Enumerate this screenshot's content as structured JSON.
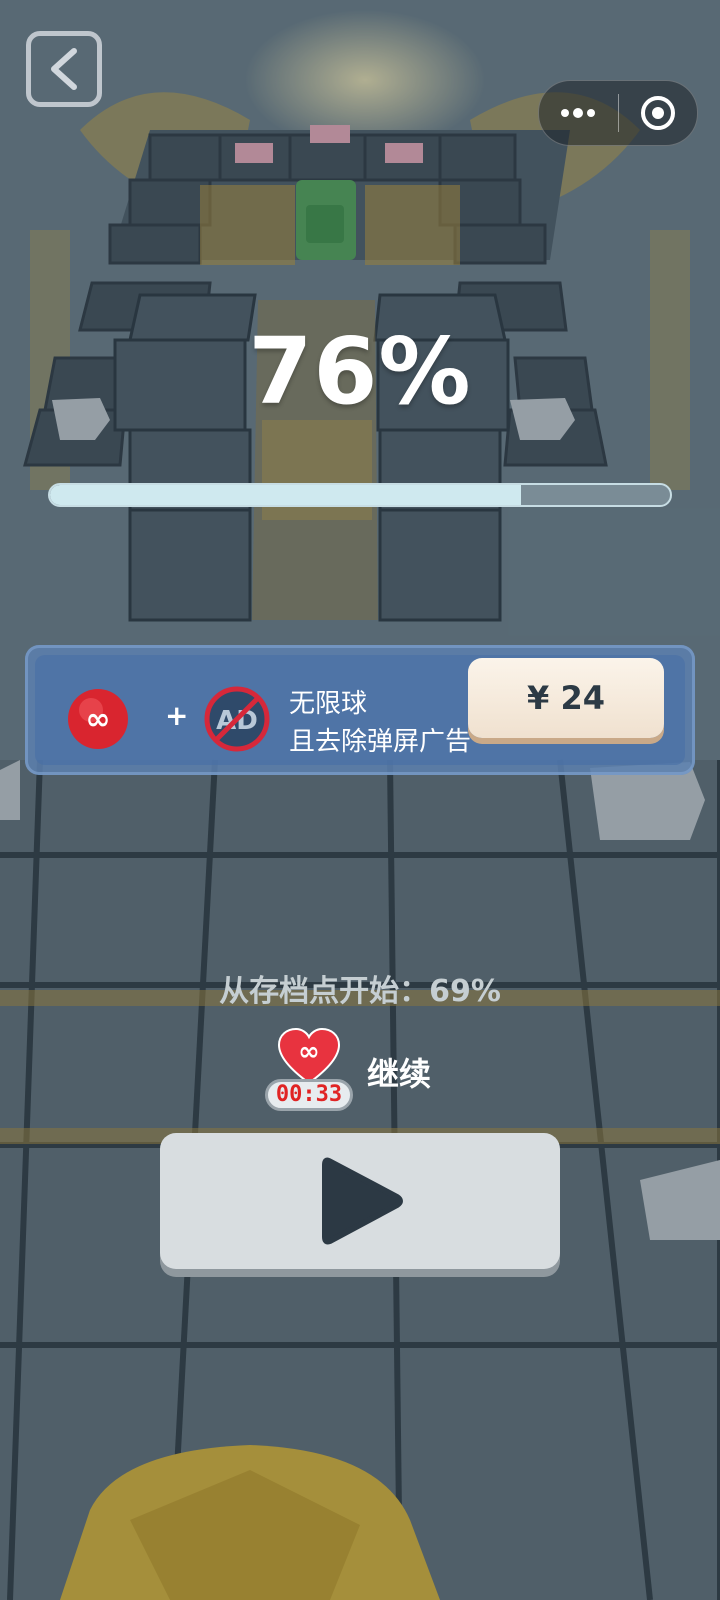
{
  "header": {
    "back_icon": "back-arrow-icon",
    "more_icon": "more-dots-icon",
    "close_icon": "target-circle-icon"
  },
  "progress": {
    "percent_label": "76%",
    "fraction": 0.76
  },
  "offer": {
    "ball_icon": "infinity-ball-icon",
    "infinity_glyph": "∞",
    "plus": "+",
    "noad_icon": "no-ad-icon",
    "noad_glyph": "AD",
    "line1": "无限球",
    "line2": "且去除弹屏广告",
    "price": "¥ 24"
  },
  "revive": {
    "checkpoint_text": "从存档点开始：69%",
    "heart_glyph": "∞",
    "timer": "00:33",
    "continue_label": "继续",
    "play_icon": "play-icon"
  },
  "colors": {
    "banner": "#5c80af",
    "price_bg": "#fbf4ea",
    "progress_fill": "#cfe9ef",
    "timer_text": "#e02424",
    "heart": "#e8333f"
  }
}
